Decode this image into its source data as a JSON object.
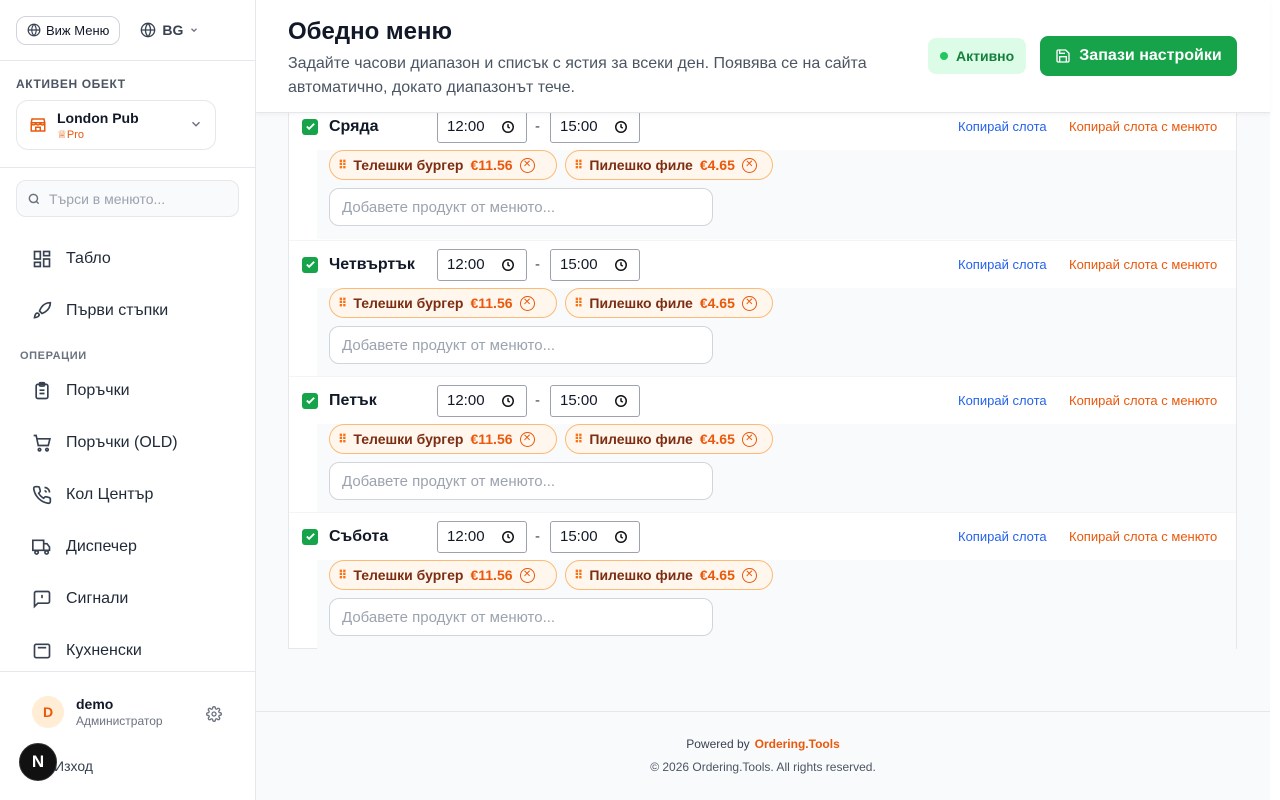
{
  "sidebar": {
    "view_menu_label": "Виж Меню",
    "language": "BG",
    "active_venue_label": "АКТИВЕН ОБЕКТ",
    "venue_name": "London Pub",
    "venue_plan": "Pro",
    "search_placeholder": "Търси в менюто...",
    "nav_top": [
      {
        "label": "Табло",
        "icon": "dashboard-icon"
      },
      {
        "label": "Първи стъпки",
        "icon": "rocket-icon"
      }
    ],
    "operations_label": "ОПЕРАЦИИ",
    "nav_ops": [
      {
        "label": "Поръчки",
        "icon": "clipboard-icon"
      },
      {
        "label": "Поръчки (OLD)",
        "icon": "cart-icon"
      },
      {
        "label": "Кол Център",
        "icon": "phone-icon"
      },
      {
        "label": "Диспечер",
        "icon": "truck-icon"
      },
      {
        "label": "Сигнали",
        "icon": "alert-message-icon"
      },
      {
        "label": "Кухненски",
        "icon": "kitchen-icon"
      }
    ],
    "user": {
      "initial": "D",
      "name": "demo",
      "role": "Администратор",
      "logout": "Изход"
    },
    "next_badge": "N"
  },
  "header": {
    "title": "Обедно меню",
    "description": "Задайте часови диапазон и списък с ястия за всеки ден. Появява се на сайта автоматично, докато диапазонът тече.",
    "status": "Активно",
    "save_label": "Запази настройки"
  },
  "days": [
    {
      "name": "Сряда",
      "checked": true,
      "from": "12:00",
      "to": "15:00",
      "copy_slot": "Копирай слота",
      "copy_slot_menu": "Копирай слота с менюто",
      "items": [
        {
          "name": "Телешки бургер",
          "price": "€11.56"
        },
        {
          "name": "Пилешко филе",
          "price": "€4.65"
        }
      ],
      "add_placeholder": "Добавете продукт от менюто..."
    },
    {
      "name": "Четвъртък",
      "checked": true,
      "from": "12:00",
      "to": "15:00",
      "copy_slot": "Копирай слота",
      "copy_slot_menu": "Копирай слота с менюто",
      "items": [
        {
          "name": "Телешки бургер",
          "price": "€11.56"
        },
        {
          "name": "Пилешко филе",
          "price": "€4.65"
        }
      ],
      "add_placeholder": "Добавете продукт от менюто..."
    },
    {
      "name": "Петък",
      "checked": true,
      "from": "12:00",
      "to": "15:00",
      "copy_slot": "Копирай слота",
      "copy_slot_menu": "Копирай слота с менюто",
      "items": [
        {
          "name": "Телешки бургер",
          "price": "€11.56"
        },
        {
          "name": "Пилешко филе",
          "price": "€4.65"
        }
      ],
      "add_placeholder": "Добавете продукт от менюто..."
    },
    {
      "name": "Събота",
      "checked": true,
      "from": "12:00",
      "to": "15:00",
      "copy_slot": "Копирай слота",
      "copy_slot_menu": "Копирай слота с менюто",
      "items": [
        {
          "name": "Телешки бургер",
          "price": "€11.56"
        },
        {
          "name": "Пилешко филе",
          "price": "€4.65"
        }
      ],
      "add_placeholder": "Добавете продукт от менюто..."
    }
  ],
  "footer": {
    "powered_by": "Powered by",
    "brand": "Ordering.Tools",
    "copyright": "© 2026 Ordering.Tools. All rights reserved."
  },
  "colors": {
    "accent_green": "#16a34a",
    "accent_orange": "#ea580c",
    "link_blue": "#2563eb"
  }
}
